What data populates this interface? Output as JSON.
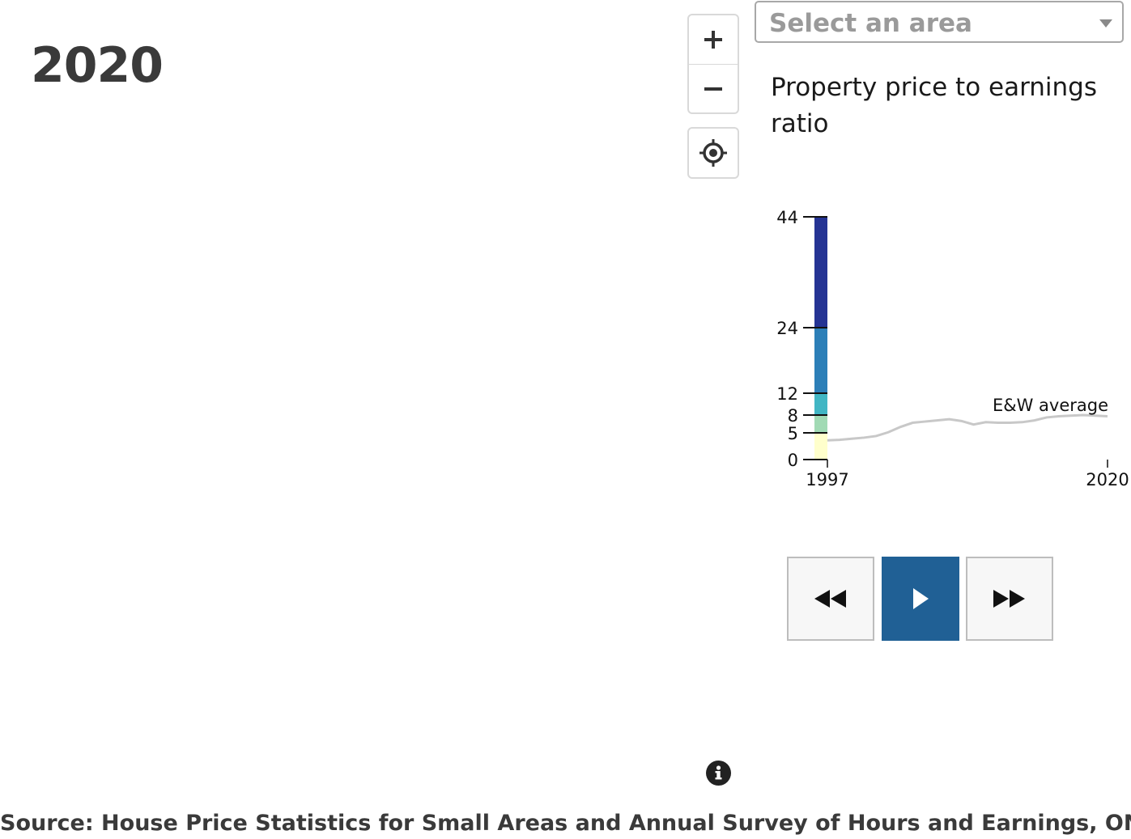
{
  "header": {
    "year": "2020"
  },
  "map_controls": {
    "zoom_in": "+",
    "zoom_out": "−"
  },
  "area_select": {
    "placeholder": "Select an area"
  },
  "legend": {
    "title": "Property price to earnings ratio"
  },
  "chart_data": {
    "type": "line",
    "color_scale": {
      "breaks": [
        0,
        5,
        8,
        12,
        24,
        44
      ],
      "tick_labels": [
        "0",
        "5",
        "8",
        "12",
        "24",
        "44"
      ],
      "colors": [
        "#ffffcc",
        "#a1dab4",
        "#41b6c4",
        "#2c7fb8",
        "#253494"
      ]
    },
    "x_ticks": [
      "1997",
      "2020"
    ],
    "xlim": [
      1997,
      2020
    ],
    "ylim": [
      0,
      44
    ],
    "annotation": "E&W average",
    "series": [
      {
        "x": [
          1997,
          1998,
          1999,
          2000,
          2001,
          2002,
          2003,
          2004,
          2005,
          2006,
          2007,
          2008,
          2009,
          2010,
          2011,
          2012,
          2013,
          2014,
          2015,
          2016,
          2017,
          2018,
          2019,
          2020
        ],
        "values": [
          3.6,
          3.7,
          3.9,
          4.1,
          4.4,
          5.1,
          6.0,
          6.7,
          6.9,
          7.1,
          7.3,
          7.0,
          6.4,
          6.8,
          6.7,
          6.7,
          6.8,
          7.1,
          7.6,
          7.8,
          7.9,
          8.0,
          7.9,
          7.8
        ],
        "color": "#c8c8c8"
      }
    ]
  },
  "player": {
    "back_label": "previous",
    "play_label": "play",
    "forward_label": "next",
    "accent": "#206095"
  },
  "footer": {
    "source": "Source: House Price Statistics for Small Areas and Annual Survey of Hours and Earnings, ONS"
  }
}
